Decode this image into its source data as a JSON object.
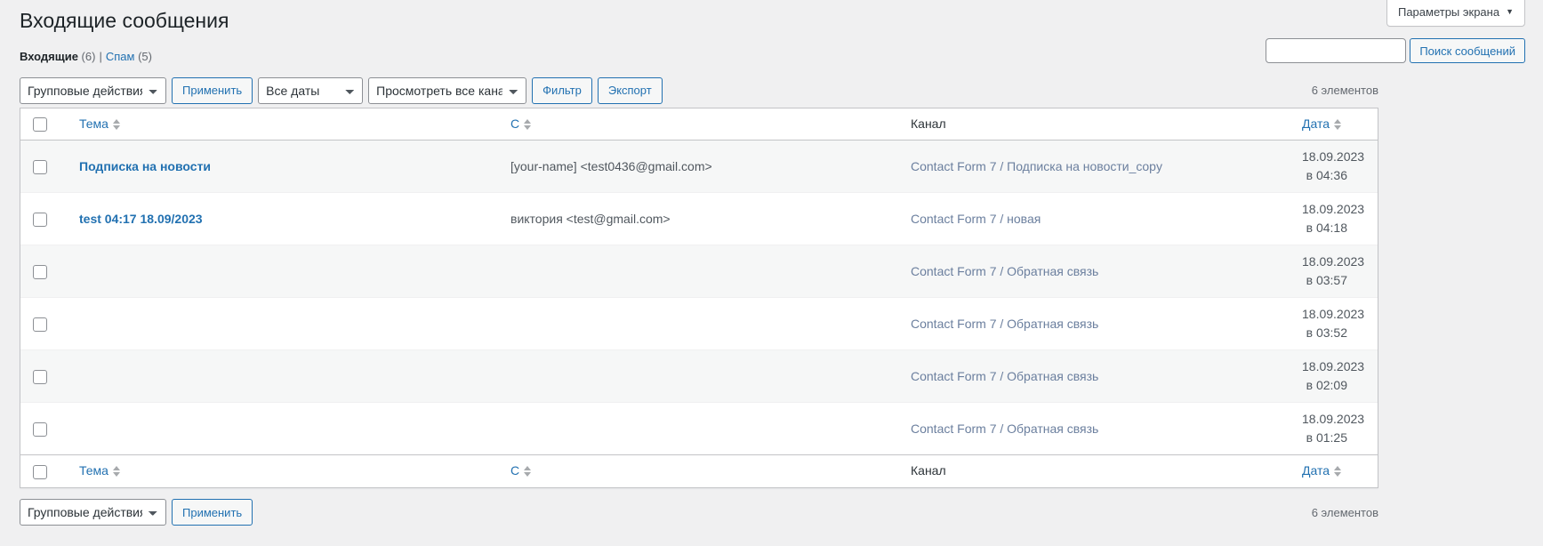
{
  "screen_meta": {
    "options_label": "Параметры экрана",
    "caret": "▼"
  },
  "header": {
    "title": "Входящие сообщения"
  },
  "views": {
    "inbox_label": "Входящие",
    "inbox_count": "(6)",
    "separator": "|",
    "spam_label": "Спам",
    "spam_count": "(5)"
  },
  "search": {
    "value": "",
    "placeholder": "",
    "button_label": "Поиск сообщений"
  },
  "toolbar_top": {
    "bulk_action_selected": "Групповые действия",
    "apply_label": "Применить",
    "date_filter_selected": "Все даты",
    "channel_filter_selected": "Просмотреть все каналы",
    "filter_label": "Фильтр",
    "export_label": "Экспорт",
    "displaying_num": "6 элементов"
  },
  "toolbar_bottom": {
    "bulk_action_selected": "Групповые действия",
    "apply_label": "Применить",
    "displaying_num": "6 элементов"
  },
  "table": {
    "columns": {
      "subject": "Тема",
      "from": "С",
      "channel": "Канал",
      "date": "Дата"
    },
    "rows": [
      {
        "subject": "Подписка на новости",
        "from": "[your-name] <test0436@gmail.com>",
        "channel": "Contact Form 7 / Подписка на новости_copy",
        "date": "18.09.2023 в 04:36"
      },
      {
        "subject": "test 04:17 18.09/2023",
        "from": "виктория <test@gmail.com>",
        "channel": "Contact Form 7 / новая",
        "date": "18.09.2023 в 04:18"
      },
      {
        "subject": "",
        "from": "",
        "channel": "Contact Form 7 / Обратная связь",
        "date": "18.09.2023 в 03:57"
      },
      {
        "subject": "",
        "from": "",
        "channel": "Contact Form 7 / Обратная связь",
        "date": "18.09.2023 в 03:52"
      },
      {
        "subject": "",
        "from": "",
        "channel": "Contact Form 7 / Обратная связь",
        "date": "18.09.2023 в 02:09"
      },
      {
        "subject": "",
        "from": "",
        "channel": "Contact Form 7 / Обратная связь",
        "date": "18.09.2023 в 01:25"
      }
    ]
  },
  "colors": {
    "link": "#2271b1",
    "background": "#f0f0f1",
    "alt_row": "#f6f7f7",
    "border": "#c3c4c7"
  }
}
